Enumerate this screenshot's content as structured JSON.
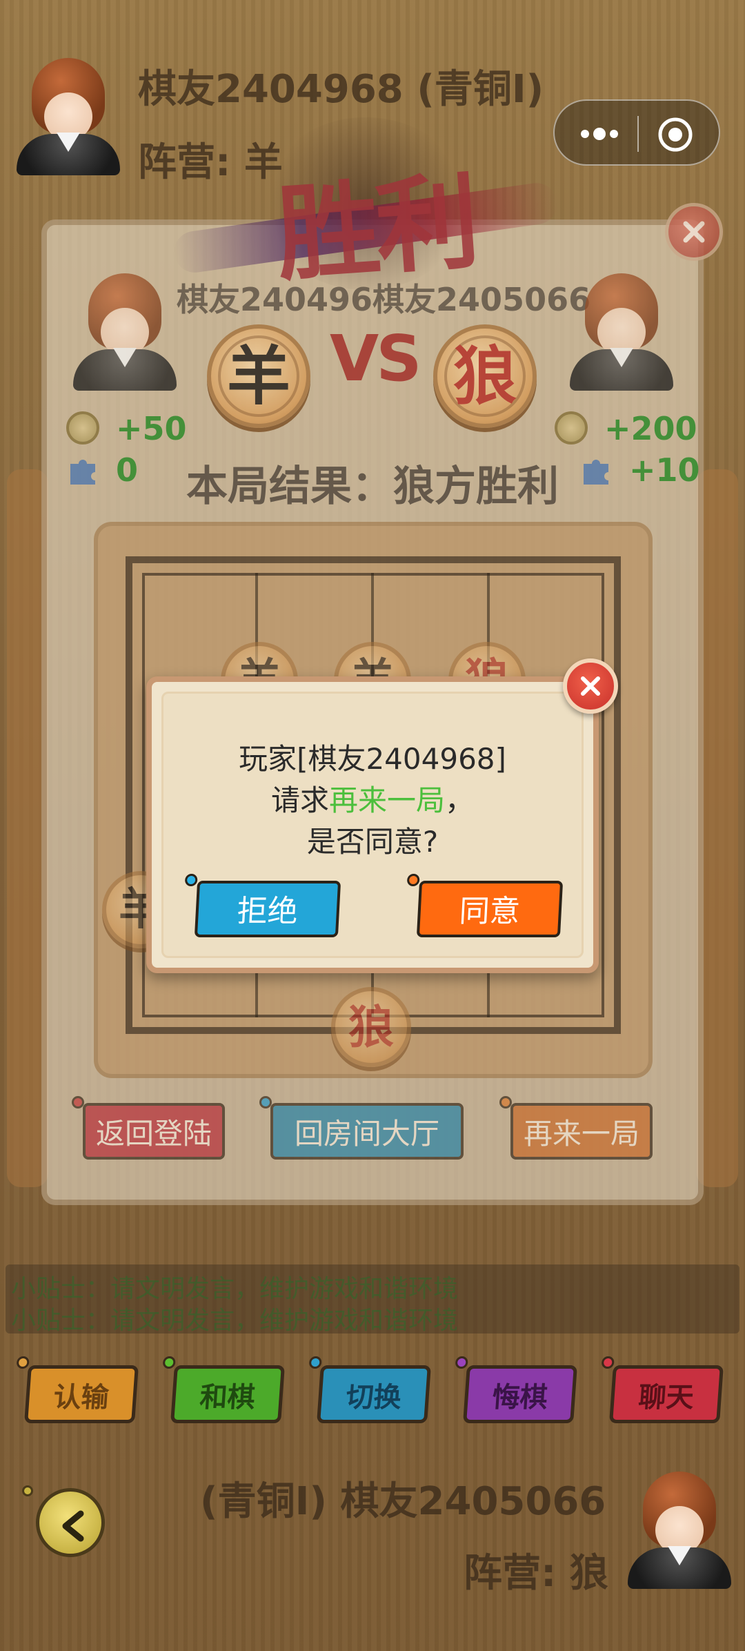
{
  "header": {
    "player_name": "棋友2404968 (青铜I)",
    "player_camp": "阵营: 羊"
  },
  "result_panel": {
    "title": "胜利",
    "vs_names": "棋友240496棋友2405066",
    "vs_label": "VS",
    "left_piece": "羊",
    "right_piece": "狼",
    "left_coins": "+50",
    "left_points": "0",
    "right_coins": "+200",
    "right_points": "+10",
    "round_result": "本局结果：狼方胜利",
    "board_pieces": [
      "羊",
      "羊",
      "狼",
      "羊",
      "狼"
    ],
    "buttons": {
      "back_login": "返回登陆",
      "back_lobby": "回房间大厅",
      "play_again": "再来一局"
    }
  },
  "chat": {
    "lines": [
      "小贴士：请文明发言，维护游戏和谐环境",
      "小贴士：请文明发言，维护游戏和谐环境"
    ]
  },
  "actions": {
    "resign": "认输",
    "draw": "和棋",
    "switch": "切换",
    "undo": "悔棋",
    "chat": "聊天"
  },
  "opponent": {
    "player_name": "(青铜I) 棋友2405066",
    "player_camp": "阵营: 狼"
  },
  "dialog": {
    "line1": "玩家[棋友2404968]",
    "line2_prefix": "请求",
    "line2_highlight": "再来一局",
    "line2_suffix": "，",
    "line3": "是否同意?",
    "reject_label": "拒绝",
    "accept_label": "同意"
  },
  "colors": {
    "reject_button": "#23a6d8",
    "accept_button": "#ff6a10",
    "highlight_text": "#4cbf3c"
  }
}
